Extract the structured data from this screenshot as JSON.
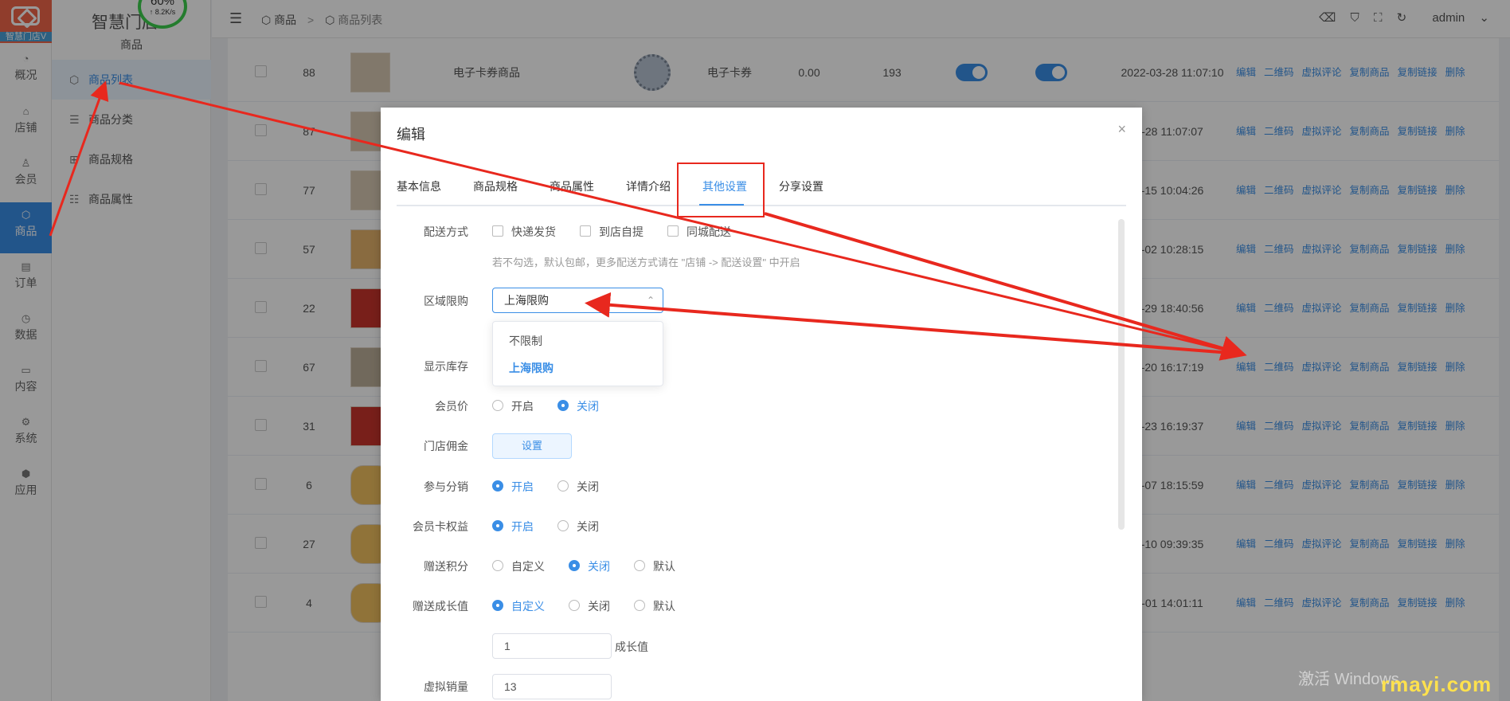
{
  "app": {
    "brand": "智慧门店",
    "logo_text": "智慧门店V",
    "submenu_title": "商品",
    "net_percent": "60%",
    "net_speed": "↑ 8.2K/s"
  },
  "rail": [
    {
      "label": "概况",
      "icon": "dashboard-icon",
      "glyph": "◔"
    },
    {
      "label": "店铺",
      "icon": "store-icon",
      "glyph": "⌂"
    },
    {
      "label": "会员",
      "icon": "user-icon",
      "glyph": "♙"
    },
    {
      "label": "商品",
      "icon": "cube-icon",
      "glyph": "⬡"
    },
    {
      "label": "订单",
      "icon": "order-icon",
      "glyph": "▤"
    },
    {
      "label": "数据",
      "icon": "pie-chart-icon",
      "glyph": "◷"
    },
    {
      "label": "内容",
      "icon": "folder-icon",
      "glyph": "▭"
    },
    {
      "label": "系统",
      "icon": "gear-icon",
      "glyph": "⚙"
    },
    {
      "label": "应用",
      "icon": "app-icon",
      "glyph": "⬢"
    }
  ],
  "submenu": [
    {
      "label": "商品列表",
      "icon": "cube-icon",
      "glyph": "⬡"
    },
    {
      "label": "商品分类",
      "icon": "list-icon",
      "glyph": "☰"
    },
    {
      "label": "商品规格",
      "icon": "spec-icon",
      "glyph": "⊞"
    },
    {
      "label": "商品属性",
      "icon": "sliders-icon",
      "glyph": "☷"
    }
  ],
  "topbar": {
    "menu_icon": "☰",
    "crumb": [
      "商品",
      "商品列表"
    ],
    "crumb_sep": ">",
    "user": "admin",
    "icons": [
      "clear-icon",
      "shirt-icon",
      "fullscreen-icon",
      "refresh-icon"
    ]
  },
  "table": {
    "ops": [
      "编辑",
      "二维码",
      "虚拟评论",
      "复制商品",
      "复制链接",
      "删除"
    ],
    "rows": [
      {
        "id": "88",
        "name": "电子卡券商品",
        "type": "电子卡券",
        "price": "0.00",
        "stock": "193",
        "time": "2022-03-28 11:07:10",
        "thumb": "pale"
      },
      {
        "id": "87",
        "name": "",
        "type": "",
        "price": "",
        "stock": "",
        "time": "-28 11:07:07",
        "thumb": "pale"
      },
      {
        "id": "77",
        "name": "",
        "type": "",
        "price": "",
        "stock": "",
        "time": "-15 10:04:26",
        "thumb": "pale"
      },
      {
        "id": "57",
        "name": "",
        "type": "",
        "price": "",
        "stock": "",
        "time": "-02 10:28:15",
        "thumb": "cake"
      },
      {
        "id": "22",
        "name": "",
        "type": "",
        "price": "",
        "stock": "",
        "time": "-29 18:40:56",
        "thumb": "red"
      },
      {
        "id": "67",
        "name": "",
        "type": "",
        "price": "",
        "stock": "",
        "time": "-20 16:17:19",
        "thumb": "wood"
      },
      {
        "id": "31",
        "name": "",
        "type": "",
        "price": "",
        "stock": "",
        "time": "-23 16:19:37",
        "thumb": "red"
      },
      {
        "id": "6",
        "name": "",
        "type": "",
        "price": "",
        "stock": "",
        "time": "-07 18:15:59",
        "thumb": "tiger"
      },
      {
        "id": "27",
        "name": "",
        "type": "",
        "price": "",
        "stock": "",
        "time": "-10 09:39:35",
        "thumb": "tiger"
      },
      {
        "id": "4",
        "name": "",
        "type": "",
        "price": "",
        "stock": "",
        "time": "-01 14:01:11",
        "thumb": "tiger"
      }
    ]
  },
  "dialog": {
    "title": "编辑",
    "close": "×",
    "tabs": [
      "基本信息",
      "商品规格",
      "商品属性",
      "详情介绍",
      "其他设置",
      "分享设置"
    ],
    "active_tab": "其他设置",
    "delivery": {
      "label": "配送方式",
      "options": [
        "快递发货",
        "到店自提",
        "同城配送"
      ],
      "hint": "若不勾选，默认包邮，更多配送方式请在 \"店铺 -> 配送设置\" 中开启"
    },
    "region": {
      "label": "区域限购",
      "value": "上海限购",
      "caret": "⌃",
      "options": [
        "不限制",
        "上海限购"
      ]
    },
    "show_stock": {
      "label": "显示库存"
    },
    "member_price": {
      "label": "会员价",
      "options": [
        "开启",
        "关闭"
      ],
      "selected": "关闭"
    },
    "commission": {
      "label": "门店佣金",
      "button": "设置"
    },
    "distribution": {
      "label": "参与分销",
      "options": [
        "开启",
        "关闭"
      ],
      "selected": "开启"
    },
    "card_rights": {
      "label": "会员卡权益",
      "options": [
        "开启",
        "关闭"
      ],
      "selected": "开启"
    },
    "points": {
      "label": "赠送积分",
      "options": [
        "自定义",
        "关闭",
        "默认"
      ],
      "selected": "关闭"
    },
    "growth": {
      "label": "赠送成长值",
      "options": [
        "自定义",
        "关闭",
        "默认"
      ],
      "selected": "自定义",
      "value": "1",
      "unit": "成长值"
    },
    "virtual_sales": {
      "label": "虚拟销量",
      "value": "13"
    }
  },
  "watermark": {
    "activate": "激活 Windows",
    "site": "rmayi.com"
  },
  "annotation_color": "#e8281e",
  "accent_color": "#3a8ee6"
}
